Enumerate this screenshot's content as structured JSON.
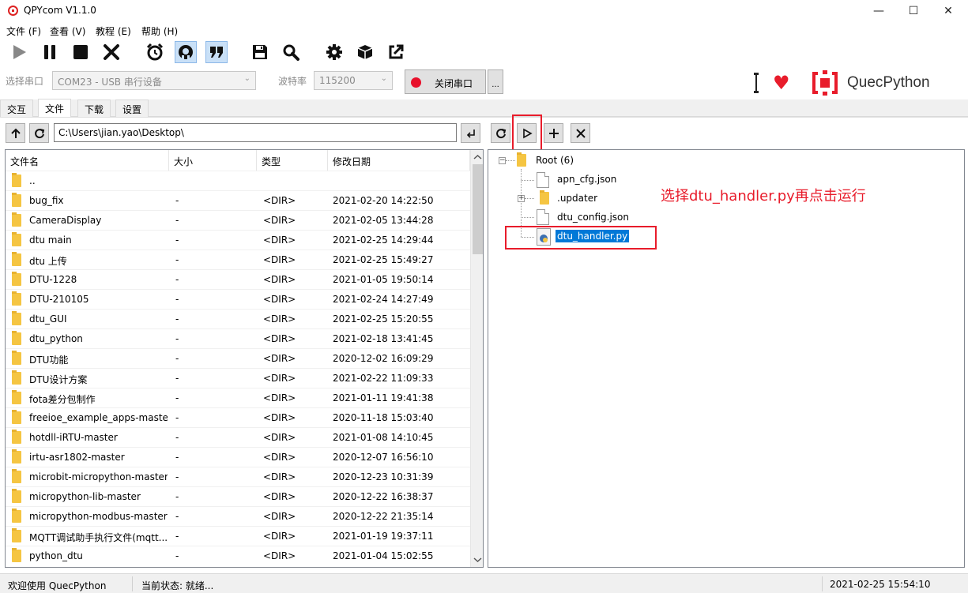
{
  "window": {
    "title": "QPYcom V1.1.0",
    "controls": {
      "minimize": "—",
      "maximize": "☐",
      "close": "✕"
    }
  },
  "menu": [
    {
      "label": "文件 (F)"
    },
    {
      "label": "查看 (V)"
    },
    {
      "label": "教程 (E)"
    },
    {
      "label": "帮助 (H)"
    }
  ],
  "toolbar": {
    "icons": [
      "play-icon",
      "pause-icon",
      "stop-icon",
      "clear-icon",
      "alarm-icon",
      "hex-icon",
      "quote-icon",
      "save-icon",
      "search-icon",
      "settings-icon",
      "package-icon",
      "export-icon"
    ]
  },
  "serial": {
    "port_label": "选择串口",
    "port_value": "COM23 - USB 串行设备",
    "baud_label": "波特率",
    "baud_value": "115200",
    "close_button": "关闭串口",
    "more_button": "..."
  },
  "brand": {
    "text": "QuecPython",
    "accent": "#e81c2b"
  },
  "tabs": [
    {
      "label": "交互"
    },
    {
      "label": "文件",
      "active": true
    },
    {
      "label": "下载"
    },
    {
      "label": "设置"
    }
  ],
  "local": {
    "path": "C:\\Users\\jian.yao\\Desktop\\",
    "columns": [
      "文件名",
      "大小",
      "类型",
      "修改日期"
    ],
    "rows": [
      {
        "name": "..",
        "size": "",
        "type": "",
        "date": ""
      },
      {
        "name": "bug_fix",
        "size": "-",
        "type": "<DIR>",
        "date": "2021-02-20 14:22:50"
      },
      {
        "name": "CameraDisplay",
        "size": "-",
        "type": "<DIR>",
        "date": "2021-02-05 13:44:28"
      },
      {
        "name": "dtu main",
        "size": "-",
        "type": "<DIR>",
        "date": "2021-02-25 14:29:44"
      },
      {
        "name": "dtu 上传",
        "size": "-",
        "type": "<DIR>",
        "date": "2021-02-25 15:49:27"
      },
      {
        "name": "DTU-1228",
        "size": "-",
        "type": "<DIR>",
        "date": "2021-01-05 19:50:14"
      },
      {
        "name": "DTU-210105",
        "size": "-",
        "type": "<DIR>",
        "date": "2021-02-24 14:27:49"
      },
      {
        "name": "dtu_GUI",
        "size": "-",
        "type": "<DIR>",
        "date": "2021-02-25 15:20:55"
      },
      {
        "name": "dtu_python",
        "size": "-",
        "type": "<DIR>",
        "date": "2021-02-18 13:41:45"
      },
      {
        "name": "DTU功能",
        "size": "-",
        "type": "<DIR>",
        "date": "2020-12-02 16:09:29"
      },
      {
        "name": "DTU设计方案",
        "size": "-",
        "type": "<DIR>",
        "date": "2021-02-22 11:09:33"
      },
      {
        "name": "fota差分包制作",
        "size": "-",
        "type": "<DIR>",
        "date": "2021-01-11 19:41:38"
      },
      {
        "name": "freeioe_example_apps-master",
        "size": "-",
        "type": "<DIR>",
        "date": "2020-11-18 15:03:40"
      },
      {
        "name": "hotdll-iRTU-master",
        "size": "-",
        "type": "<DIR>",
        "date": "2021-01-08 14:10:45"
      },
      {
        "name": "irtu-asr1802-master",
        "size": "-",
        "type": "<DIR>",
        "date": "2020-12-07 16:56:10"
      },
      {
        "name": "microbit-micropython-master",
        "size": "-",
        "type": "<DIR>",
        "date": "2020-12-23 10:31:39"
      },
      {
        "name": "micropython-lib-master",
        "size": "-",
        "type": "<DIR>",
        "date": "2020-12-22 16:38:37"
      },
      {
        "name": "micropython-modbus-master",
        "size": "-",
        "type": "<DIR>",
        "date": "2020-12-22 21:35:14"
      },
      {
        "name": "MQTT调试助手执行文件(mqtt...",
        "size": "-",
        "type": "<DIR>",
        "date": "2021-01-19 19:37:11"
      },
      {
        "name": "python_dtu",
        "size": "-",
        "type": "<DIR>",
        "date": "2021-01-04 15:02:55"
      }
    ]
  },
  "device": {
    "root_label": "Root (6)",
    "nodes": [
      {
        "name": "apn_cfg.json",
        "kind": "file"
      },
      {
        "name": ".updater",
        "kind": "folder"
      },
      {
        "name": "dtu_config.json",
        "kind": "file"
      },
      {
        "name": "dtu_handler.py",
        "kind": "python",
        "selected": true
      }
    ],
    "annotation": "选择dtu_handler.py再点击运行"
  },
  "status": {
    "welcome": "欢迎使用 QuecPython",
    "state": "当前状态: 就绪...",
    "datetime": "2021-02-25 15:54:10"
  }
}
